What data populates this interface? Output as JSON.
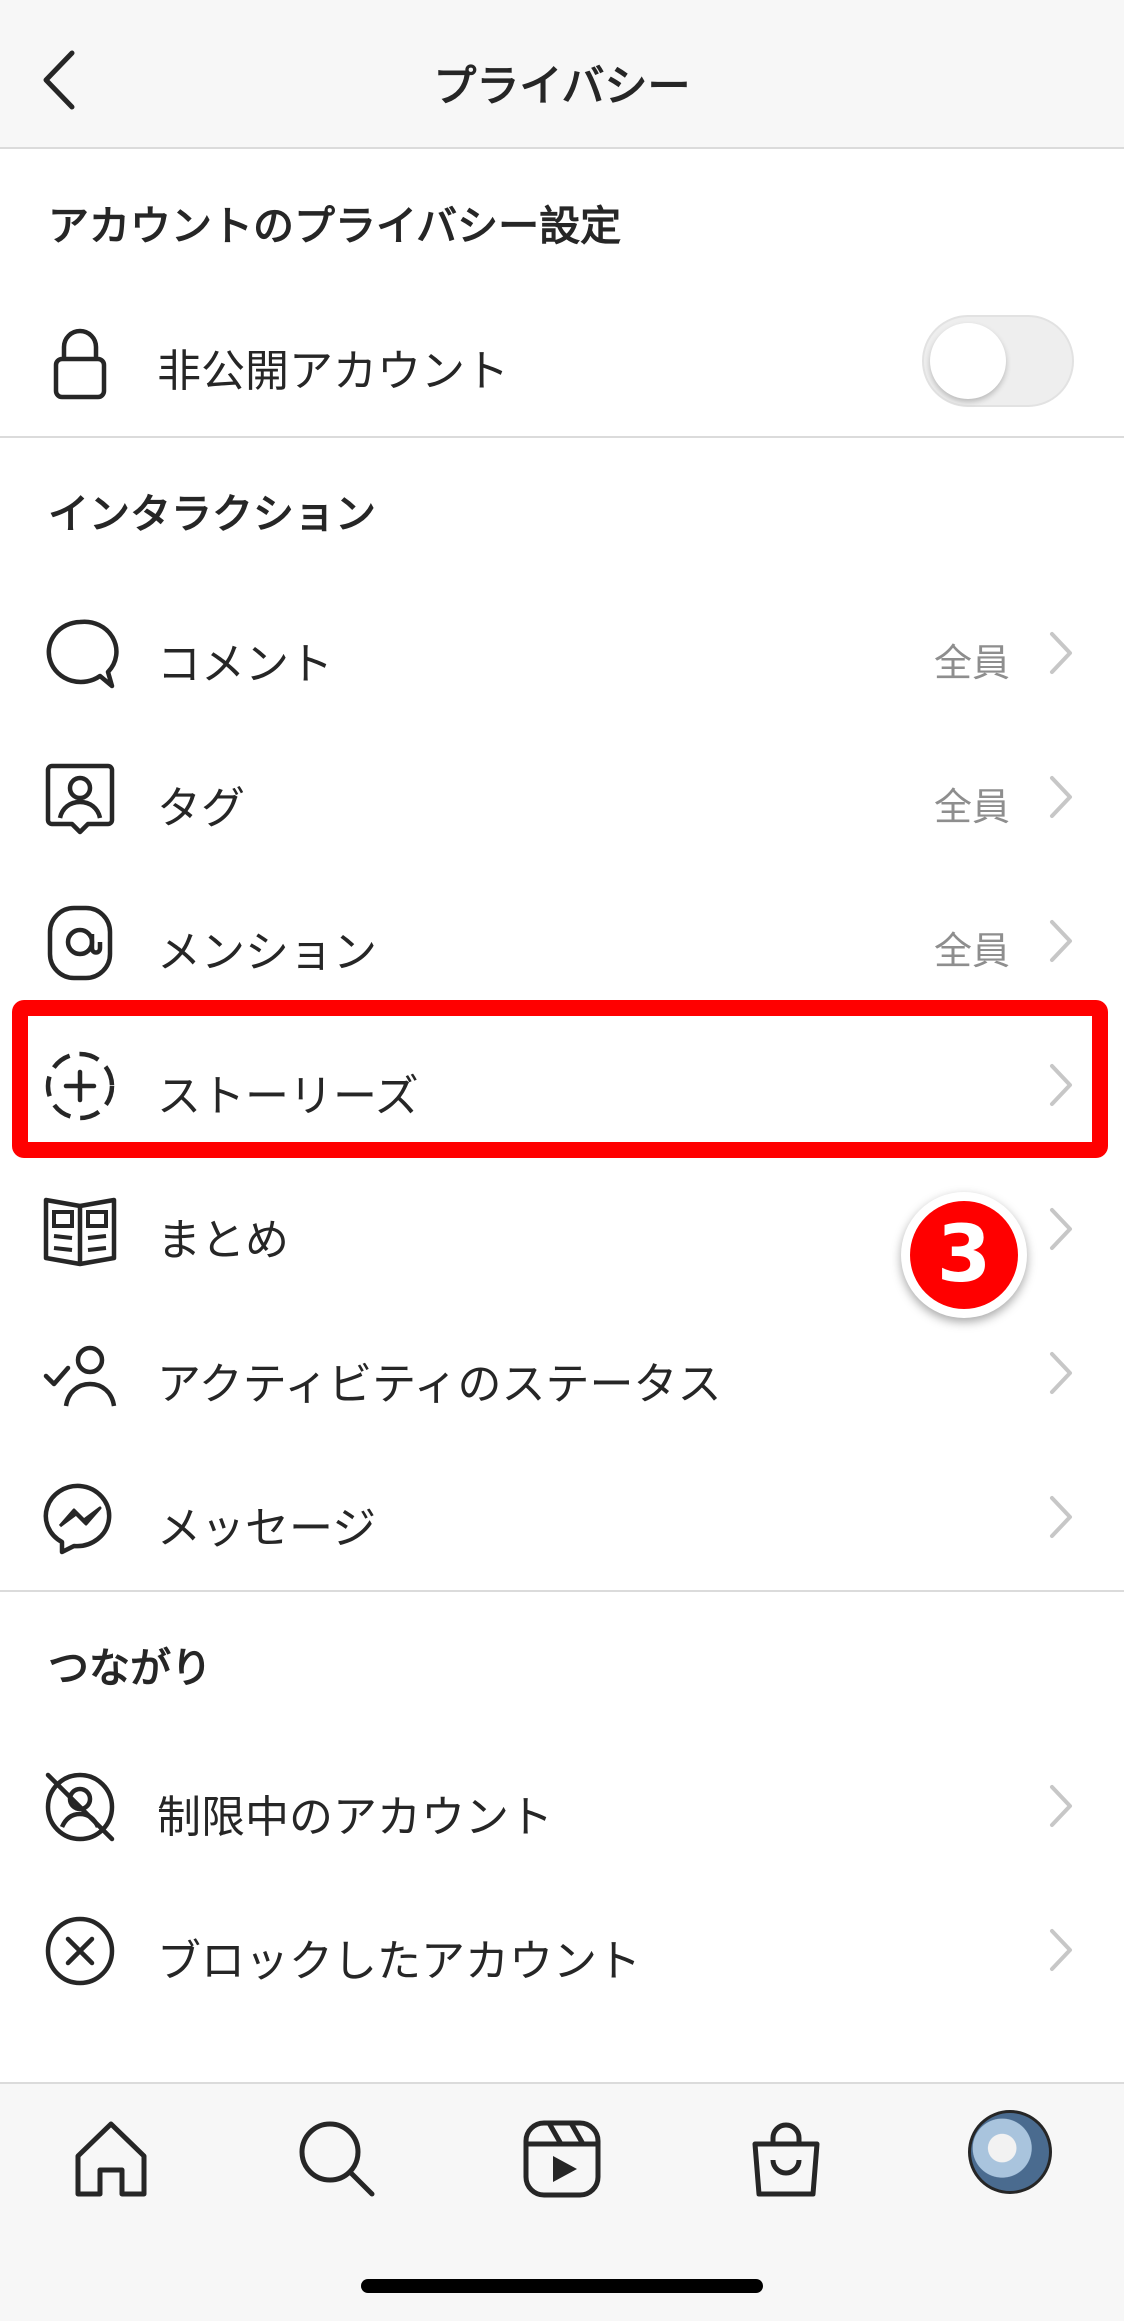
{
  "header": {
    "title": "プライバシー"
  },
  "account_section": {
    "title": "アカウントのプライバシー設定",
    "private_account": {
      "label": "非公開アカウント",
      "enabled": false
    }
  },
  "interaction_section": {
    "title": "インタラクション",
    "items": [
      {
        "label": "コメント",
        "value": "全員",
        "icon": "comment-icon"
      },
      {
        "label": "タグ",
        "value": "全員",
        "icon": "tag-person-icon"
      },
      {
        "label": "メンション",
        "value": "全員",
        "icon": "at-mention-icon"
      },
      {
        "label": "ストーリーズ",
        "value": "",
        "icon": "story-add-icon"
      },
      {
        "label": "まとめ",
        "value": "",
        "icon": "guide-book-icon"
      },
      {
        "label": "アクティビティのステータス",
        "value": "",
        "icon": "activity-status-icon"
      },
      {
        "label": "メッセージ",
        "value": "",
        "icon": "messenger-icon"
      }
    ]
  },
  "connections_section": {
    "title": "つながり",
    "items": [
      {
        "label": "制限中のアカウント",
        "icon": "restricted-icon"
      },
      {
        "label": "ブロックしたアカウント",
        "icon": "blocked-icon"
      }
    ]
  },
  "annotation": {
    "step_number": "3",
    "highlight_color": "#ff0000"
  },
  "tabbar": {
    "items": [
      "home-icon",
      "search-icon",
      "reels-icon",
      "shop-icon",
      "profile-avatar"
    ]
  },
  "colors": {
    "text": "#262626",
    "secondary": "#8e8e8e",
    "divider": "#dbdbdb",
    "bar_bg": "#f7f7f7"
  }
}
